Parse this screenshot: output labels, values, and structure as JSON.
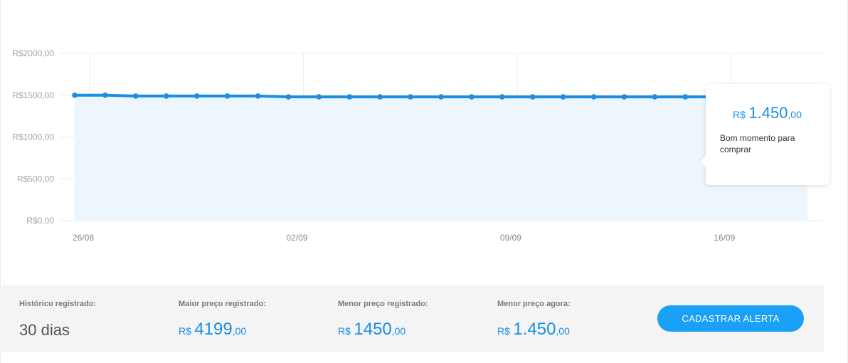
{
  "chart_data": {
    "type": "area",
    "ylim": [
      0,
      2000
    ],
    "y_ticks": [
      "R$2000,00",
      "R$1500,00",
      "R$1000,00",
      "R$500,00",
      "R$0,00"
    ],
    "y_tick_values": [
      2000,
      1500,
      1000,
      500,
      0
    ],
    "x_ticks": [
      "26/08",
      "02/09",
      "09/09",
      "16/09"
    ],
    "x_tick_index": [
      0,
      7,
      14,
      21
    ],
    "grid": true,
    "series_color": "#1a8ee6",
    "fill_color": "#eef6fd",
    "series": [
      {
        "values": [
          1500,
          1500,
          1490,
          1490,
          1490,
          1490,
          1490,
          1480,
          1480,
          1480,
          1480,
          1480,
          1480,
          1480,
          1480,
          1480,
          1480,
          1480,
          1480,
          1480,
          1480,
          1480,
          1450,
          1450,
          1450
        ]
      }
    ]
  },
  "tooltip": {
    "currency": "R$",
    "price_int": "1.450",
    "price_dec": ",00",
    "message": "Bom momento para comprar"
  },
  "stats": {
    "history": {
      "label": "Histórico registrado:",
      "value": "30 dias"
    },
    "max": {
      "label": "Maior preço registrado:",
      "currency": "R$",
      "int": "4199",
      "dec": ",00"
    },
    "min": {
      "label": "Menor preço registrado:",
      "currency": "R$",
      "int": "1450",
      "dec": ",00"
    },
    "now": {
      "label": "Menor preço agora:",
      "currency": "R$",
      "int": "1.450",
      "dec": ",00"
    }
  },
  "alert_button": {
    "label": "CADASTRAR ALERTA"
  }
}
